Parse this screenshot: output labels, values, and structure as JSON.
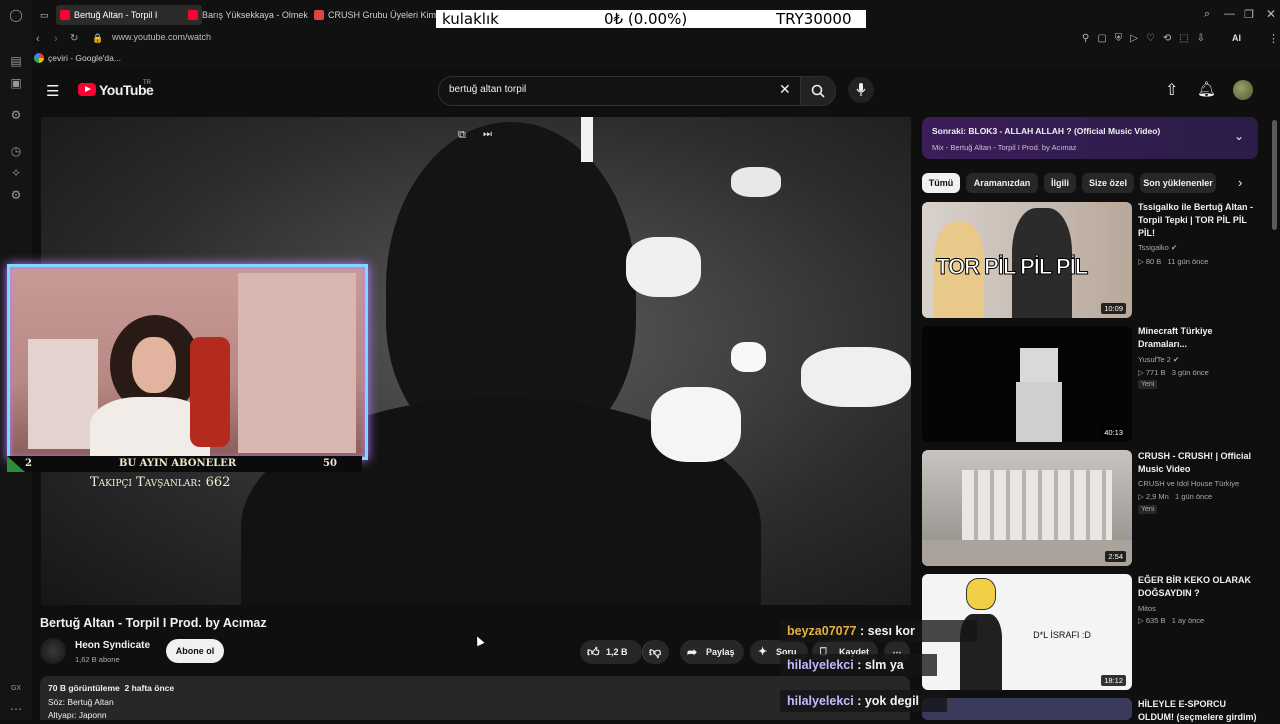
{
  "browser": {
    "tabs": [
      {
        "title": "Bertuğ Altan - Torpil I",
        "active": true
      },
      {
        "title": "Barış Yüksekkaya - Olmek",
        "active": false
      },
      {
        "title": "CRUSH Grubu Üyeleri Kim",
        "active": false
      }
    ],
    "url": "www.youtube.com/watch",
    "bookmark": "çeviri - Google'da...",
    "brand_color": "#ff0033"
  },
  "stock_bar": {
    "name": "kulaklık",
    "change": "0₺ (0.00%)",
    "value": "TRY30000"
  },
  "youtube": {
    "logo": "YouTube",
    "region": "TR",
    "search_value": "bertuğ altan torpil"
  },
  "video": {
    "title": "Bertuğ Altan - Torpil I Prod. by Acımaz",
    "channel": "Heon Syndicate",
    "subscribers": "1,62 B abone",
    "subscribe_label": "Abone ol",
    "likes": "1,2 B",
    "share_label": "Paylaş",
    "ask_label": "Soru",
    "save_label": "Kaydet",
    "views_line": "70 B görüntüleme  2 hafta önce",
    "desc_line1": "Söz: Bertuğ Altan",
    "desc_line2": "Altyapı: Japonn"
  },
  "next_up": {
    "title": "Sonraki: BLOK3 - ALLAH ALLAH ? (Official Music Video)",
    "subtitle": "Mix - Bertuğ Altan - Torpil I Prod. by Acımaz"
  },
  "chips": [
    "Tümü",
    "Aramanızdan",
    "İlgili",
    "Size özel",
    "Son yüklenenler"
  ],
  "recommendations": [
    {
      "title": "Tssigalko ile Bertuğ Altan - Torpil Tepki | TOR PİL PİL PİL!",
      "channel": "Tssigalko",
      "meta": "▷ 80 B   11 gün önce",
      "badge": "",
      "duration": "10:09",
      "thumb_text": "TOR PİL PİL PİL"
    },
    {
      "title": "Minecraft Türkiye Dramaları...",
      "channel": "YusufTe 2",
      "meta": "▷ 771 B   3 gün önce",
      "badge": "Yeni",
      "duration": "40:13",
      "thumb_text": ""
    },
    {
      "title": "CRUSH - CRUSH! | Official Music Video",
      "channel": "CRUSH ve Idol House Türkiye",
      "meta": "▷ 2,9 Mn   1 gün önce",
      "badge": "Yeni",
      "duration": "2:54",
      "thumb_text": ""
    },
    {
      "title": "EĞER BİR KEKO OLARAK DOĞSAYDIN ?",
      "channel": "Mitos",
      "meta": "▷ 635 B   1 ay önce",
      "badge": "",
      "duration": "18:12",
      "thumb_text": "D*L İSRAFI :D"
    },
    {
      "title": "HİLEYLE E-SPORCU OLDUM! (seçmelere girdim)",
      "channel": "",
      "meta": "",
      "badge": "",
      "duration": "",
      "thumb_text": ""
    }
  ],
  "stream_overlay": {
    "goal_label": "BU AYIN ABONELER",
    "goal_current": "2",
    "goal_target": "50",
    "followers_text": "Takipçi Tavşanlar: 662"
  },
  "chat": [
    {
      "user": "beyza07077",
      "message": "sesı kor",
      "user_color": "#e6b23c"
    },
    {
      "user": "hilalyelekci",
      "message": "slm ya",
      "user_color": "#c8b7ff"
    },
    {
      "user": "hilalyelekci",
      "message": "yok degil",
      "user_color": "#c8b7ff"
    }
  ]
}
